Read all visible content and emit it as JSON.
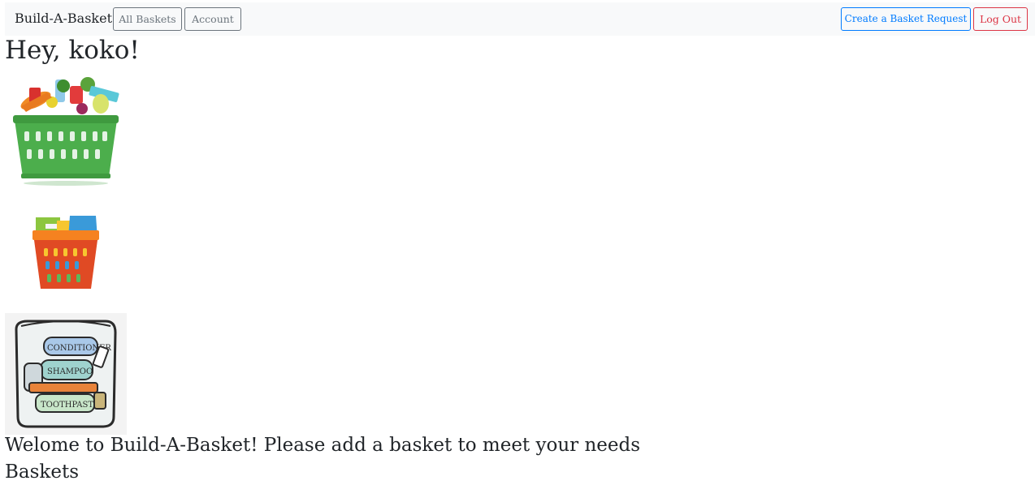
{
  "navbar": {
    "brand": "Build-A-Basket",
    "all_baskets_label": "All Baskets",
    "account_label": "Account",
    "create_request_label": "Create a Basket Request",
    "logout_label": "Log Out"
  },
  "main": {
    "greeting": "Hey, koko!",
    "images": [
      {
        "name": "grocery-basket-image"
      },
      {
        "name": "laundry-basket-image"
      },
      {
        "name": "toiletry-bag-image",
        "labels": [
          "CONDITIONER",
          "SHAMPOO",
          "TOOTHPASTE"
        ]
      }
    ],
    "welcome_message": "Welome to Build-A-Basket! Please add a basket to meet your needs",
    "baskets_heading": "Baskets"
  },
  "colors": {
    "primary": "#007bff",
    "secondary": "#6c757d",
    "danger": "#dc3545",
    "navbar_bg": "#f8f9fa"
  }
}
